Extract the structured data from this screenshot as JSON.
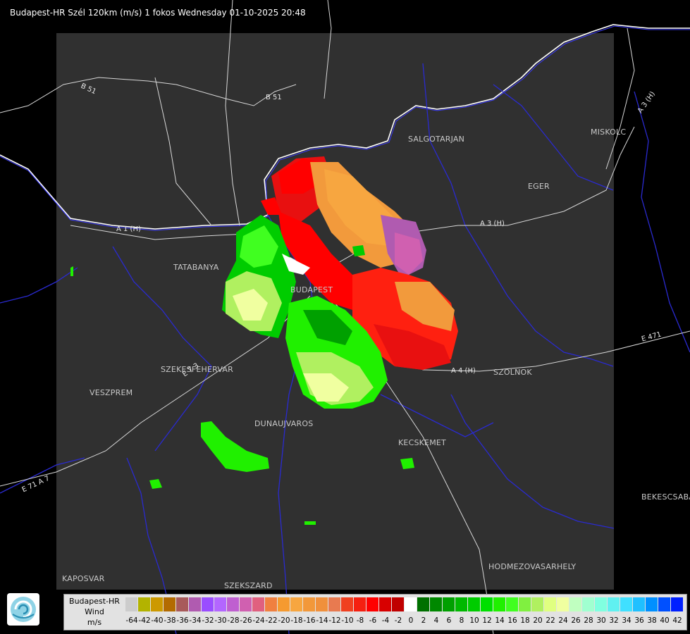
{
  "title": "Budapest-HR Szél 120km (m/s) 1 fokos Wednesday 01-10-2025 20:48",
  "cities": {
    "salgotarjan": "SALGOTARJAN",
    "miskolc": "MISKOLC",
    "eger": "EGER",
    "tatabanya": "TATABANYA",
    "budapest": "BUDAPEST",
    "szolnok": "SZOLNOK",
    "szekesfehervar": "SZEKESFEHERVAR",
    "veszprem": "VESZPREM",
    "dunaujvaros": "DUNAUJVAROS",
    "kecskemet": "KECSKEMET",
    "bekescsaba": "BEKESCSABA",
    "kaposvar": "KAPOSVAR",
    "szekszard": "SZEKSZARD",
    "hodmezovasarhely": "HODMEZOVASARHELY"
  },
  "roads": {
    "b51_a": "B 51",
    "b51_b": "B 51",
    "a1": "A 1 (H)",
    "a3": "A 3 (H)",
    "a3_ne": "A 3 (H)",
    "a4": "A 4 (H)",
    "e471": "E 471",
    "e71": "E 71 A 7",
    "e73": "E 7 3"
  },
  "legend": {
    "label_line1": "Budapest-HR",
    "label_line2": "Wind",
    "label_line3": "m/s",
    "ticks": [
      "-64",
      "-42",
      "-40",
      "-38",
      "-36",
      "-34",
      "-32",
      "-30",
      "-28",
      "-26",
      "-24",
      "-22",
      "-20",
      "-18",
      "-16",
      "-14",
      "-12",
      "-10",
      "-8",
      "-6",
      "-4",
      "-2",
      "0",
      "2",
      "4",
      "6",
      "8",
      "10",
      "12",
      "14",
      "16",
      "18",
      "20",
      "22",
      "24",
      "26",
      "28",
      "30",
      "32",
      "34",
      "36",
      "38",
      "40",
      "42"
    ],
    "colors": [
      "#cccccc",
      "#b3b300",
      "#cc9900",
      "#b36b00",
      "#a85a5a",
      "#b05bb0",
      "#9a4dff",
      "#b366ff",
      "#bf5fd0",
      "#d060b0",
      "#e0607f",
      "#f08040",
      "#f59a30",
      "#f7a640",
      "#f2983a",
      "#f0903c",
      "#e87a50",
      "#f04020",
      "#f52010",
      "#ff0000",
      "#d80000",
      "#c00000",
      "#ffffff",
      "#007000",
      "#008800",
      "#00a000",
      "#00b800",
      "#00cc00",
      "#00e000",
      "#20f000",
      "#40ff20",
      "#80f040",
      "#b0f060",
      "#e0ff80",
      "#f0ffa0",
      "#c0ffc0",
      "#a0ffd0",
      "#80ffe0",
      "#60f0f0",
      "#40e0ff",
      "#20c0ff",
      "#0090ff",
      "#0050ff",
      "#0020ff"
    ]
  }
}
